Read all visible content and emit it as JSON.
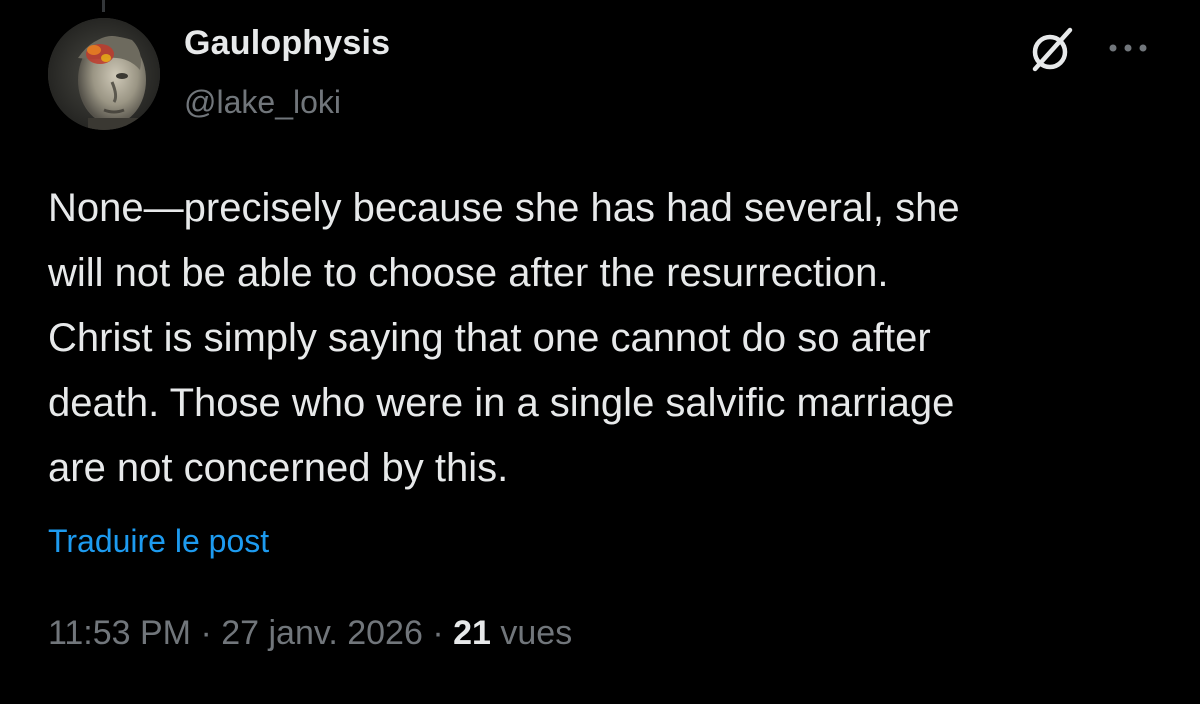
{
  "author": {
    "display_name": "Gaulophysis",
    "handle": "@lake_loki",
    "avatar_icon": "statue-head-avatar"
  },
  "header_actions": {
    "grok_icon": "grok-icon",
    "more_icon": "more-dots-icon"
  },
  "post": {
    "text": "None—precisely because she has had several, she\nwill not be able to choose after the resurrection.\nChrist is simply saying that one cannot do so after\ndeath. Those who were in a single salvific marriage\nare not concerned by this.",
    "translate_label": "Traduire le post"
  },
  "meta": {
    "time": "11:53 PM",
    "separator": " · ",
    "date": "27 janv. 2026",
    "views_count": "21",
    "views_label": "vues"
  },
  "colors": {
    "background": "#000000",
    "text_primary": "#e7e9ea",
    "text_secondary": "#71767b",
    "link": "#1d9bf0"
  }
}
